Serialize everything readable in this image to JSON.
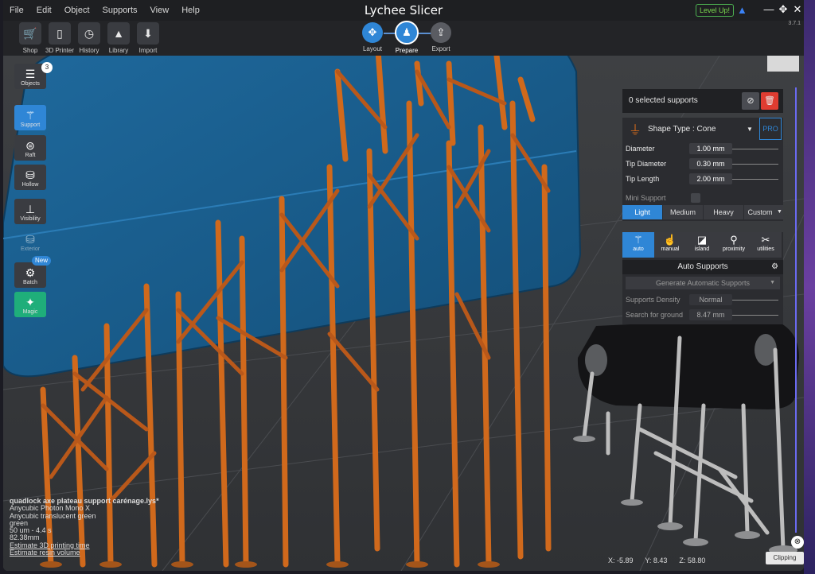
{
  "window": {
    "title": "Lychee Slicer",
    "version": "3.7.1"
  },
  "menu": [
    "File",
    "Edit",
    "Object",
    "Supports",
    "View",
    "Help"
  ],
  "level_up": "Level Up!",
  "toolbar": [
    {
      "label": "Shop",
      "icon": "cart-icon"
    },
    {
      "label": "3D Printer",
      "icon": "printer-icon"
    },
    {
      "label": "History",
      "icon": "history-icon"
    },
    {
      "label": "Library",
      "icon": "library-icon"
    },
    {
      "label": "Import",
      "icon": "import-icon"
    }
  ],
  "steps": [
    {
      "label": "Layout",
      "active": false
    },
    {
      "label": "Prepare",
      "active": true
    },
    {
      "label": "Export",
      "active": false
    }
  ],
  "left_tools": {
    "objects": {
      "label": "Objects",
      "badge": "3"
    },
    "support": "Support",
    "raft": "Raft",
    "hollow": "Hollow",
    "visibility": "Visibility",
    "exterior": "Exterior",
    "batch": {
      "label": "Batch",
      "badge": "New"
    },
    "magic": "Magic"
  },
  "panel": {
    "selected": "0 selected supports",
    "shape_type": "Shape Type : Cone",
    "pro": "PRO",
    "params": [
      {
        "label": "Diameter",
        "value": "1.00 mm"
      },
      {
        "label": "Tip Diameter",
        "value": "0.30 mm"
      },
      {
        "label": "Tip Length",
        "value": "2.00 mm"
      }
    ],
    "mini_support": "Mini Support",
    "presets": [
      "Light",
      "Medium",
      "Heavy",
      "Custom"
    ],
    "active_preset": "Light",
    "modes": [
      {
        "label": "auto",
        "icon": "auto-support-icon"
      },
      {
        "label": "manual",
        "icon": "manual-support-icon"
      },
      {
        "label": "island",
        "icon": "island-icon"
      },
      {
        "label": "proximity",
        "icon": "proximity-icon"
      },
      {
        "label": "utilities",
        "icon": "utilities-icon"
      }
    ],
    "auto_title": "Auto Supports",
    "generate": "Generate Automatic Supports",
    "density_label": "Supports Density",
    "density_value": "Normal",
    "ground_label": "Search for ground",
    "ground_value": "8.47 mm"
  },
  "info": [
    "quadlock axe plateau support carénage.lys*",
    "Anycubic Photon Mono X",
    "Anycubic translucent green",
    "green",
    "50 um - 4.4 s",
    "82.38mm",
    "Estimate 3D printing time",
    "Estimate resin volume"
  ],
  "coords": {
    "x": "X: -5.89",
    "y": "Y: 8.43",
    "z": "Z: 58.80"
  },
  "clipping": "Clipping",
  "colors": {
    "accent": "#2f86d6",
    "support": "#c8651b",
    "model": "#1d5f8f",
    "magic": "#1fae7a"
  }
}
